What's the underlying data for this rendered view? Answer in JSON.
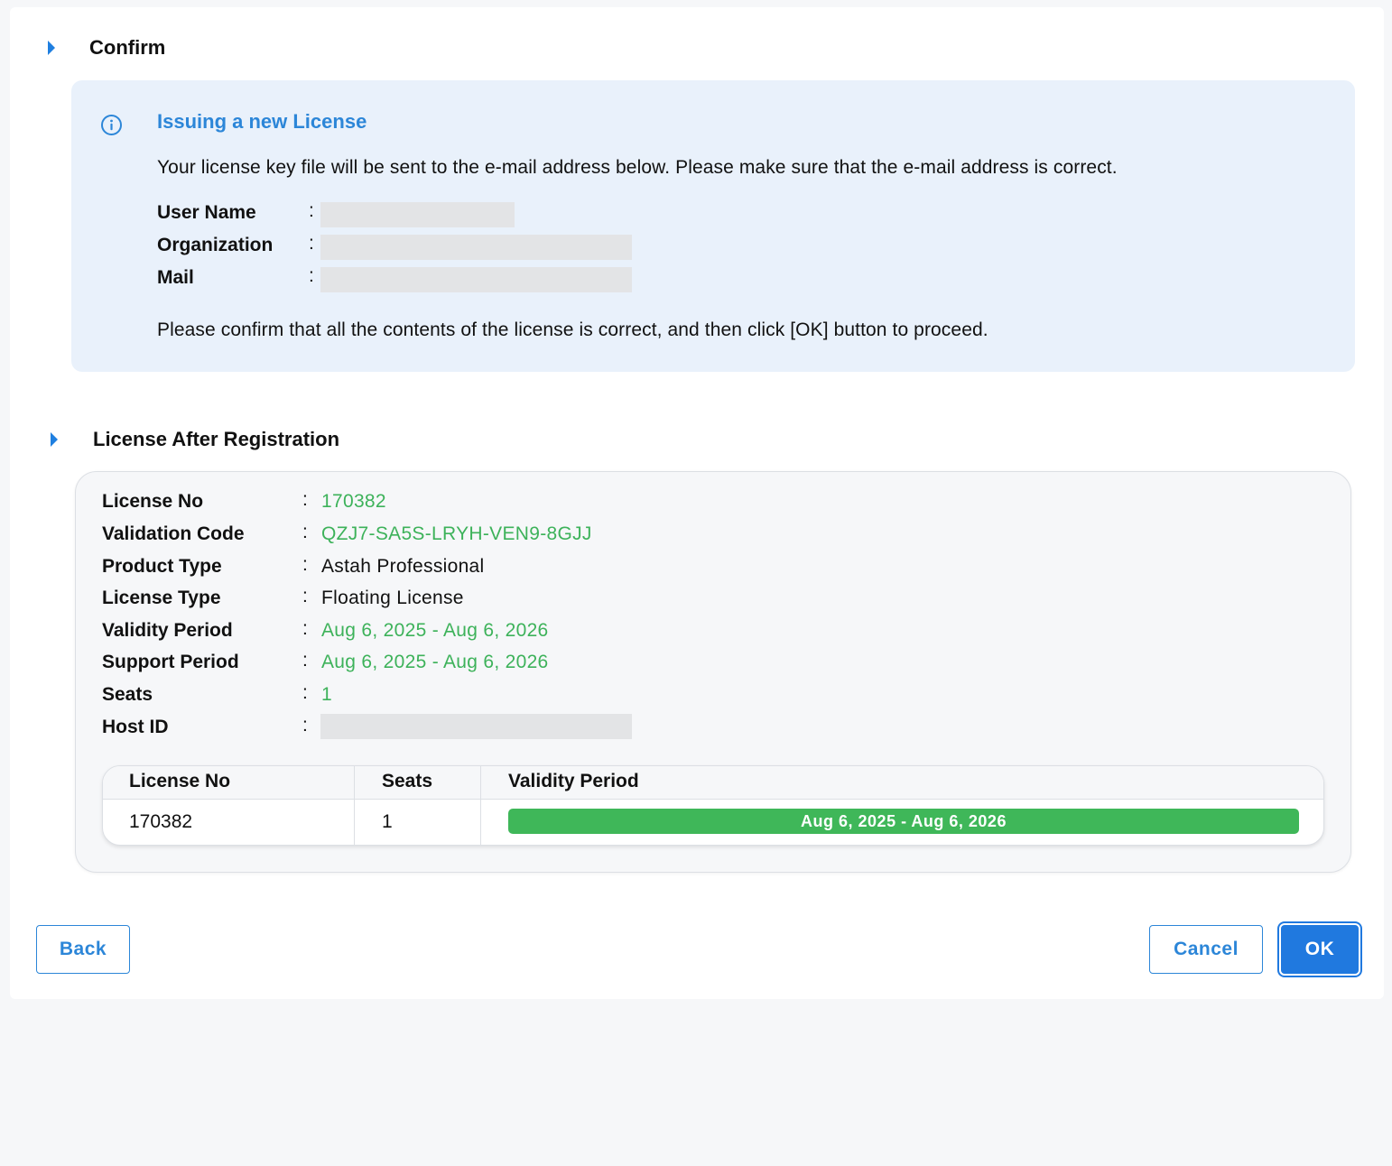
{
  "confirm_section": {
    "title": "Confirm"
  },
  "info": {
    "title": "Issuing a new License",
    "message": "Your license key file will be sent to the e-mail address below. Please make sure that the e-mail address is correct.",
    "fields": [
      {
        "label": "User Name"
      },
      {
        "label": "Organization"
      },
      {
        "label": "Mail"
      }
    ],
    "confirm_note": "Please confirm that all the contents of the license is correct, and then click [OK] button to proceed."
  },
  "license_section": {
    "title": "License After Registration",
    "fields": [
      {
        "label": "License No",
        "value": "170382"
      },
      {
        "label": "Validation Code",
        "value": "QZJ7-SA5S-LRYH-VEN9-8GJJ"
      },
      {
        "label": "Product Type",
        "value": "Astah Professional"
      },
      {
        "label": "License Type",
        "value": "Floating License"
      },
      {
        "label": "Validity Period",
        "value": "Aug 6, 2025 - Aug 6, 2026"
      },
      {
        "label": "Support Period",
        "value": "Aug 6, 2025 - Aug 6, 2026"
      },
      {
        "label": "Seats",
        "value": "1"
      },
      {
        "label": "Host ID",
        "value": ""
      }
    ],
    "colon": ":",
    "table": {
      "headers": [
        "License No",
        "Seats",
        "Validity Period"
      ],
      "rows": [
        {
          "license_no": "170382",
          "seats": "1",
          "validity": "Aug 6, 2025 - Aug 6, 2026"
        }
      ]
    }
  },
  "buttons": {
    "back": "Back",
    "cancel": "Cancel",
    "ok": "OK"
  },
  "colors": {
    "accent": "#2079df",
    "highlight_green": "#3db25a",
    "info_bg": "#e9f1fb"
  }
}
